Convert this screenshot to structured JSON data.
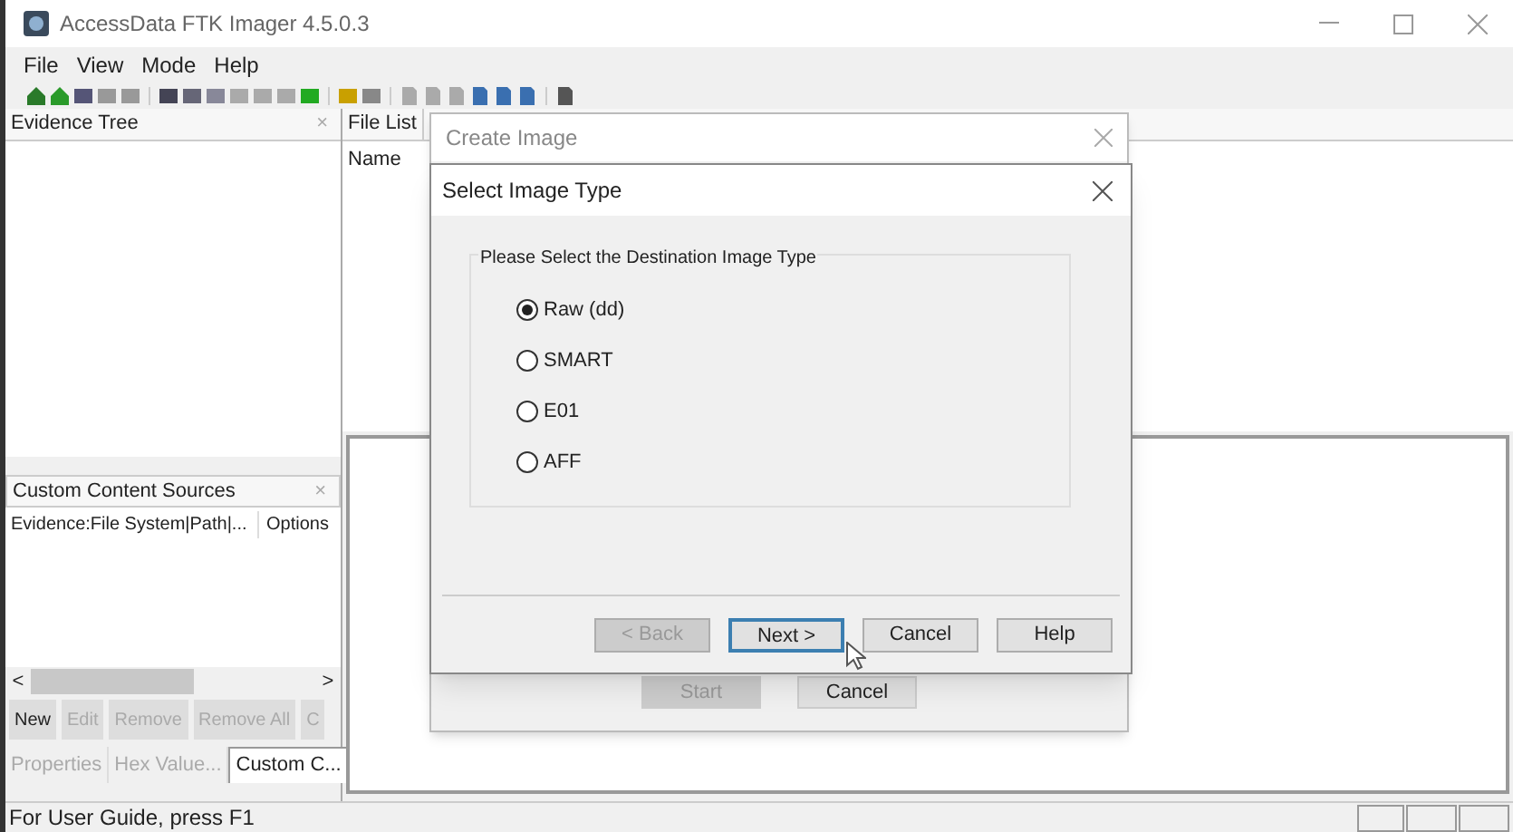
{
  "window": {
    "title": "AccessData FTK Imager 4.5.0.3"
  },
  "menu": [
    "File",
    "View",
    "Mode",
    "Help"
  ],
  "evidence_tree": {
    "title": "Evidence Tree",
    "close": "×"
  },
  "file_list": {
    "title": "File List",
    "columns": [
      "Name"
    ]
  },
  "custom_content_sources": {
    "title": "Custom Content Sources",
    "close": "×",
    "columns": [
      "Evidence:File System|Path|...",
      "Options"
    ],
    "scroll_left": "<",
    "scroll_right": ">",
    "buttons": [
      {
        "label": "New",
        "disabled": false
      },
      {
        "label": "Edit",
        "disabled": true
      },
      {
        "label": "Remove",
        "disabled": true
      },
      {
        "label": "Remove All",
        "disabled": true
      },
      {
        "label": "C",
        "disabled": true
      }
    ]
  },
  "bottom_tabs": [
    {
      "label": "Properties",
      "selected": false
    },
    {
      "label": "Hex Value...",
      "selected": false
    },
    {
      "label": "Custom C...",
      "selected": true
    }
  ],
  "status_bar": {
    "text": "For User Guide, press F1"
  },
  "create_image_dialog": {
    "title": "Create Image",
    "buttons": [
      {
        "label": "Start",
        "disabled": true
      },
      {
        "label": "Cancel",
        "disabled": false
      }
    ]
  },
  "select_image_type_dialog": {
    "title": "Select Image Type",
    "group_label": "Please Select the Destination Image Type",
    "options": [
      {
        "label": "Raw (dd)",
        "selected": true
      },
      {
        "label": "SMART",
        "selected": false
      },
      {
        "label": "E01",
        "selected": false
      },
      {
        "label": "AFF",
        "selected": false
      }
    ],
    "buttons": [
      {
        "label": "< Back",
        "disabled": true,
        "focused": false
      },
      {
        "label": "Next >",
        "disabled": false,
        "focused": true
      },
      {
        "label": "Cancel",
        "disabled": false,
        "focused": false
      },
      {
        "label": "Help",
        "disabled": false,
        "focused": false
      }
    ]
  }
}
